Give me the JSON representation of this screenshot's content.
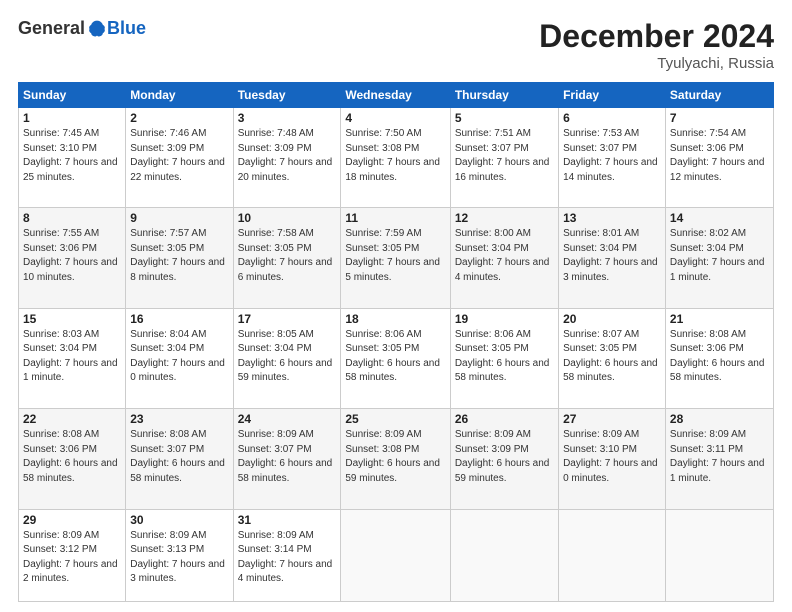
{
  "logo": {
    "general": "General",
    "blue": "Blue"
  },
  "header": {
    "month": "December 2024",
    "location": "Tyulyachi, Russia"
  },
  "weekdays": [
    "Sunday",
    "Monday",
    "Tuesday",
    "Wednesday",
    "Thursday",
    "Friday",
    "Saturday"
  ],
  "weeks": [
    [
      {
        "day": "1",
        "sunrise": "7:45 AM",
        "sunset": "3:10 PM",
        "daylight": "7 hours and 25 minutes."
      },
      {
        "day": "2",
        "sunrise": "7:46 AM",
        "sunset": "3:09 PM",
        "daylight": "7 hours and 22 minutes."
      },
      {
        "day": "3",
        "sunrise": "7:48 AM",
        "sunset": "3:09 PM",
        "daylight": "7 hours and 20 minutes."
      },
      {
        "day": "4",
        "sunrise": "7:50 AM",
        "sunset": "3:08 PM",
        "daylight": "7 hours and 18 minutes."
      },
      {
        "day": "5",
        "sunrise": "7:51 AM",
        "sunset": "3:07 PM",
        "daylight": "7 hours and 16 minutes."
      },
      {
        "day": "6",
        "sunrise": "7:53 AM",
        "sunset": "3:07 PM",
        "daylight": "7 hours and 14 minutes."
      },
      {
        "day": "7",
        "sunrise": "7:54 AM",
        "sunset": "3:06 PM",
        "daylight": "7 hours and 12 minutes."
      }
    ],
    [
      {
        "day": "8",
        "sunrise": "7:55 AM",
        "sunset": "3:06 PM",
        "daylight": "7 hours and 10 minutes."
      },
      {
        "day": "9",
        "sunrise": "7:57 AM",
        "sunset": "3:05 PM",
        "daylight": "7 hours and 8 minutes."
      },
      {
        "day": "10",
        "sunrise": "7:58 AM",
        "sunset": "3:05 PM",
        "daylight": "7 hours and 6 minutes."
      },
      {
        "day": "11",
        "sunrise": "7:59 AM",
        "sunset": "3:05 PM",
        "daylight": "7 hours and 5 minutes."
      },
      {
        "day": "12",
        "sunrise": "8:00 AM",
        "sunset": "3:04 PM",
        "daylight": "7 hours and 4 minutes."
      },
      {
        "day": "13",
        "sunrise": "8:01 AM",
        "sunset": "3:04 PM",
        "daylight": "7 hours and 3 minutes."
      },
      {
        "day": "14",
        "sunrise": "8:02 AM",
        "sunset": "3:04 PM",
        "daylight": "7 hours and 1 minute."
      }
    ],
    [
      {
        "day": "15",
        "sunrise": "8:03 AM",
        "sunset": "3:04 PM",
        "daylight": "7 hours and 1 minute."
      },
      {
        "day": "16",
        "sunrise": "8:04 AM",
        "sunset": "3:04 PM",
        "daylight": "7 hours and 0 minutes."
      },
      {
        "day": "17",
        "sunrise": "8:05 AM",
        "sunset": "3:04 PM",
        "daylight": "6 hours and 59 minutes."
      },
      {
        "day": "18",
        "sunrise": "8:06 AM",
        "sunset": "3:05 PM",
        "daylight": "6 hours and 58 minutes."
      },
      {
        "day": "19",
        "sunrise": "8:06 AM",
        "sunset": "3:05 PM",
        "daylight": "6 hours and 58 minutes."
      },
      {
        "day": "20",
        "sunrise": "8:07 AM",
        "sunset": "3:05 PM",
        "daylight": "6 hours and 58 minutes."
      },
      {
        "day": "21",
        "sunrise": "8:08 AM",
        "sunset": "3:06 PM",
        "daylight": "6 hours and 58 minutes."
      }
    ],
    [
      {
        "day": "22",
        "sunrise": "8:08 AM",
        "sunset": "3:06 PM",
        "daylight": "6 hours and 58 minutes."
      },
      {
        "day": "23",
        "sunrise": "8:08 AM",
        "sunset": "3:07 PM",
        "daylight": "6 hours and 58 minutes."
      },
      {
        "day": "24",
        "sunrise": "8:09 AM",
        "sunset": "3:07 PM",
        "daylight": "6 hours and 58 minutes."
      },
      {
        "day": "25",
        "sunrise": "8:09 AM",
        "sunset": "3:08 PM",
        "daylight": "6 hours and 59 minutes."
      },
      {
        "day": "26",
        "sunrise": "8:09 AM",
        "sunset": "3:09 PM",
        "daylight": "6 hours and 59 minutes."
      },
      {
        "day": "27",
        "sunrise": "8:09 AM",
        "sunset": "3:10 PM",
        "daylight": "7 hours and 0 minutes."
      },
      {
        "day": "28",
        "sunrise": "8:09 AM",
        "sunset": "3:11 PM",
        "daylight": "7 hours and 1 minute."
      }
    ],
    [
      {
        "day": "29",
        "sunrise": "8:09 AM",
        "sunset": "3:12 PM",
        "daylight": "7 hours and 2 minutes."
      },
      {
        "day": "30",
        "sunrise": "8:09 AM",
        "sunset": "3:13 PM",
        "daylight": "7 hours and 3 minutes."
      },
      {
        "day": "31",
        "sunrise": "8:09 AM",
        "sunset": "3:14 PM",
        "daylight": "7 hours and 4 minutes."
      },
      null,
      null,
      null,
      null
    ]
  ]
}
